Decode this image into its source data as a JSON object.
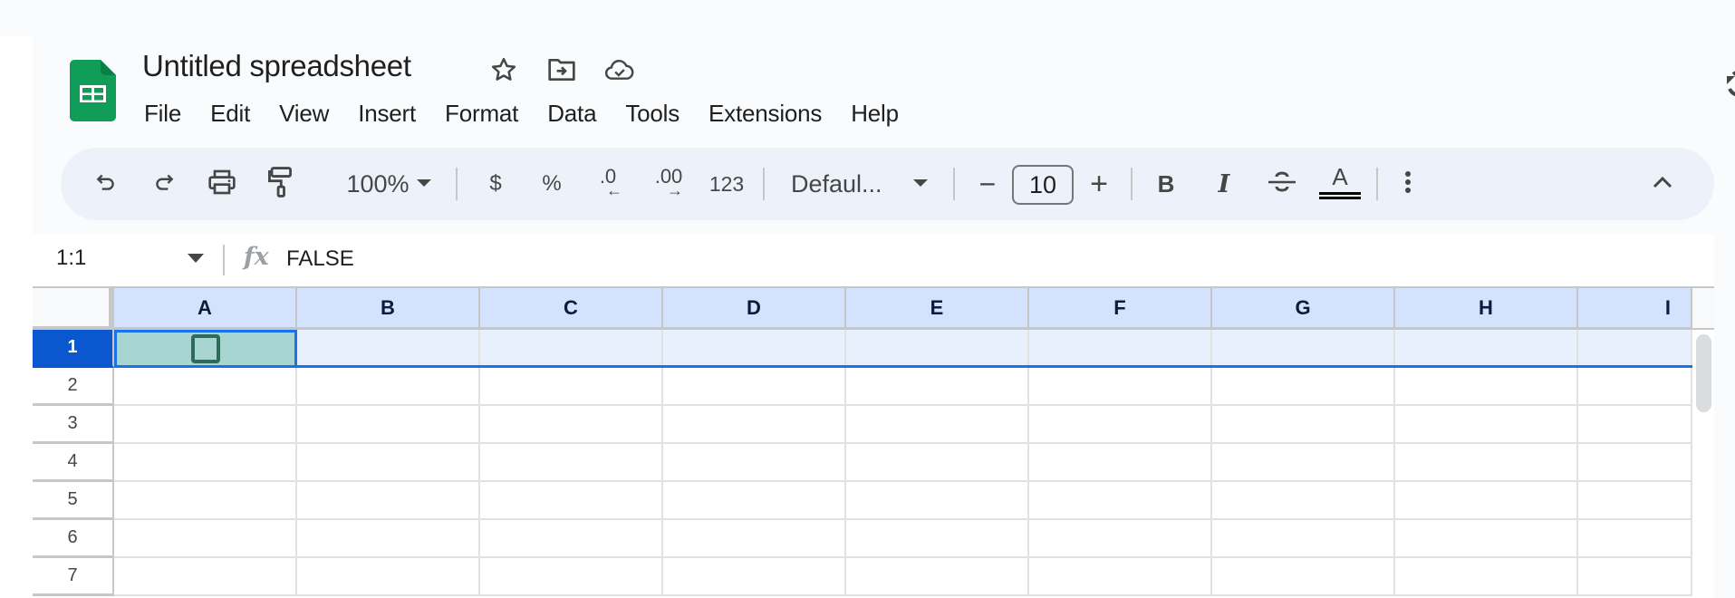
{
  "app": {
    "title": "Untitled spreadsheet",
    "brand_color": "#0f9d58"
  },
  "header_icons": [
    {
      "name": "star-icon",
      "label": "Star"
    },
    {
      "name": "move-folder-icon",
      "label": "Move"
    },
    {
      "name": "cloud-saved-icon",
      "label": "Document status"
    },
    {
      "name": "history-icon",
      "label": "Last edit"
    }
  ],
  "menu": {
    "items": [
      "File",
      "Edit",
      "View",
      "Insert",
      "Format",
      "Data",
      "Tools",
      "Extensions",
      "Help"
    ]
  },
  "toolbar": {
    "undo_icon": "undo-icon",
    "redo_icon": "redo-icon",
    "print_icon": "print-icon",
    "paint_format_icon": "paint-format-icon",
    "zoom": "100%",
    "currency_label": "$",
    "percent_label": "%",
    "decrease_decimal_label": ".0",
    "increase_decimal_label": ".00",
    "more_formats_label": "123",
    "font_family": "Defaul...",
    "decrease_font_label": "−",
    "font_size": "10",
    "increase_font_label": "+",
    "bold_label": "B",
    "italic_label": "I",
    "strikethrough_label": "S",
    "text_color_label": "A",
    "more_icon": "more-vert-icon",
    "collapse_icon": "chevron-up-icon"
  },
  "formula_bar": {
    "name_box": "1:1",
    "fx_label": "fx",
    "value": "FALSE"
  },
  "grid": {
    "columns": [
      "A",
      "B",
      "C",
      "D",
      "E",
      "F",
      "G",
      "H",
      "I"
    ],
    "rows": [
      "1",
      "2",
      "3",
      "4",
      "5",
      "6",
      "7"
    ],
    "selected_row": "1",
    "active_cell": "A1",
    "cells": {
      "A1": {
        "type": "checkbox",
        "checked": false,
        "value": "FALSE"
      }
    },
    "colors": {
      "header_bg": "#d3e3fd",
      "selected_row_header": "#0b57d0",
      "selected_row_bg": "#e8f0fe",
      "active_cell_bg": "#a8d5d1",
      "selection_border": "#1a73e8"
    }
  }
}
